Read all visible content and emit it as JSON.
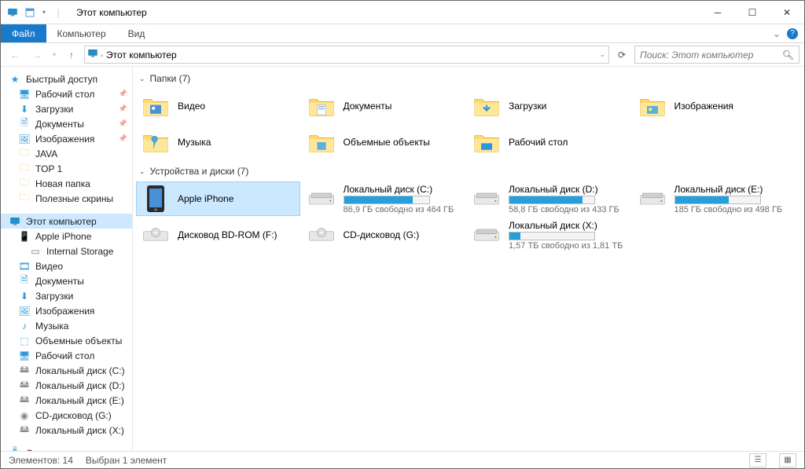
{
  "window": {
    "title": "Этот компьютер",
    "min_tooltip": "Свернуть",
    "max_tooltip": "Развернуть",
    "close_tooltip": "Закрыть"
  },
  "ribbon": {
    "file": "Файл",
    "computer": "Компьютер",
    "view": "Вид"
  },
  "breadcrumb": {
    "location": "Этот компьютер"
  },
  "search": {
    "placeholder": "Поиск: Этот компьютер"
  },
  "sidebar": {
    "quick_access": "Быстрый доступ",
    "quick": [
      {
        "label": "Рабочий стол",
        "key": "desktop"
      },
      {
        "label": "Загрузки",
        "key": "downloads"
      },
      {
        "label": "Документы",
        "key": "documents"
      },
      {
        "label": "Изображения",
        "key": "pictures"
      },
      {
        "label": "JAVA",
        "key": "java"
      },
      {
        "label": "TOP 1",
        "key": "top1"
      },
      {
        "label": "Новая папка",
        "key": "newfolder"
      },
      {
        "label": "Полезные скрины",
        "key": "screenshots"
      }
    ],
    "this_pc": "Этот компьютер",
    "pc": [
      {
        "label": "Apple iPhone",
        "key": "iphone"
      },
      {
        "label": "Internal Storage",
        "key": "internal",
        "lvl": 3
      },
      {
        "label": "Видео",
        "key": "videos"
      },
      {
        "label": "Документы",
        "key": "documents2"
      },
      {
        "label": "Загрузки",
        "key": "downloads2"
      },
      {
        "label": "Изображения",
        "key": "pictures2"
      },
      {
        "label": "Музыка",
        "key": "music"
      },
      {
        "label": "Объемные объекты",
        "key": "3d"
      },
      {
        "label": "Рабочий стол",
        "key": "desktop2"
      },
      {
        "label": "Локальный диск (C:)",
        "key": "c"
      },
      {
        "label": "Локальный диск (D:)",
        "key": "d"
      },
      {
        "label": "Локальный диск (E:)",
        "key": "e"
      },
      {
        "label": "CD-дисковод (G:)",
        "key": "g"
      },
      {
        "label": "Локальный диск (X:)",
        "key": "x"
      }
    ],
    "network": "Сеть"
  },
  "content": {
    "folders_header": "Папки (7)",
    "folders": [
      {
        "label": "Видео"
      },
      {
        "label": "Документы"
      },
      {
        "label": "Загрузки"
      },
      {
        "label": "Изображения"
      },
      {
        "label": "Музыка"
      },
      {
        "label": "Объемные объекты"
      },
      {
        "label": "Рабочий стол"
      }
    ],
    "devices_header": "Устройства и диски (7)",
    "devices": [
      {
        "label": "Apple iPhone",
        "selected": true
      },
      {
        "label": "Локальный диск (C:)",
        "sub": "86,9 ГБ свободно из 464 ГБ",
        "fill": 81
      },
      {
        "label": "Локальный диск (D:)",
        "sub": "58,8 ГБ свободно из 433 ГБ",
        "fill": 86
      },
      {
        "label": "Локальный диск (E:)",
        "sub": "185 ГБ свободно из 498 ГБ",
        "fill": 63
      },
      {
        "label": "Дисковод BD-ROM (F:)"
      },
      {
        "label": "CD-дисковод (G:)"
      },
      {
        "label": "Локальный диск (X:)",
        "sub": "1,57 ТБ свободно из 1,81 ТБ",
        "fill": 13
      }
    ]
  },
  "status": {
    "count": "Элементов: 14",
    "selection": "Выбран 1 элемент"
  }
}
